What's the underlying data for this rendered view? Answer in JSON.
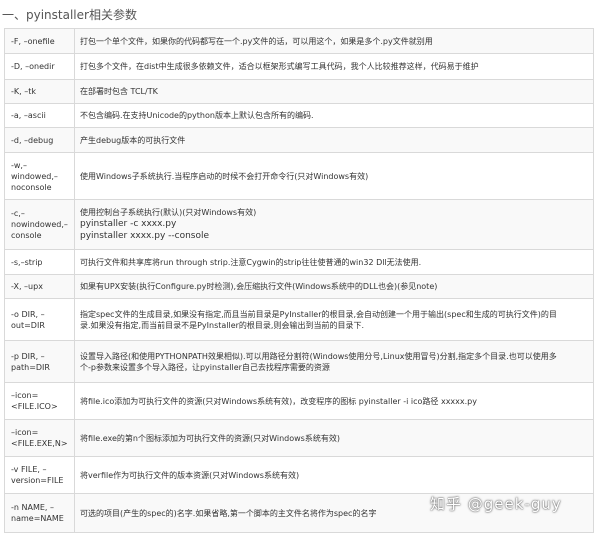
{
  "heading": "一、pyinstaller相关参数",
  "rows": [
    {
      "option": "-F, –onefile",
      "desc": [
        "打包一个单个文件，如果你的代码都写在一个.py文件的话，可以用这个，如果是多个.py文件就别用"
      ]
    },
    {
      "option": "-D, –onedir",
      "desc": [
        "打包多个文件，在dist中生成很多依赖文件，适合以框架形式编写工具代码，我个人比较推荐这样，代码易于维护"
      ]
    },
    {
      "option": "-K, –tk",
      "desc": [
        "在部署时包含 TCL/TK"
      ]
    },
    {
      "option": "-a, –ascii",
      "desc": [
        "不包含编码.在支持Unicode的python版本上默认包含所有的编码."
      ]
    },
    {
      "option": "-d, –debug",
      "desc": [
        "产生debug版本的可执行文件"
      ]
    },
    {
      "option": "-w,–windowed,–noconsole",
      "desc": [
        "使用Windows子系统执行.当程序启动的时候不会打开命令行(只对Windows有效)"
      ]
    },
    {
      "option": "-c,–nowindowed,–console",
      "desc": [
        "使用控制台子系统执行(默认)(只对Windows有效)",
        "pyinstaller -c  xxxx.py",
        "pyinstaller xxxx.py --console"
      ]
    },
    {
      "option": "-s,–strip",
      "desc": [
        "可执行文件和共享库将run through strip.注意Cygwin的strip往往使普通的win32 Dll无法使用."
      ]
    },
    {
      "option": "-X, –upx",
      "desc": [
        "如果有UPX安装(执行Configure.py时检测),会压缩执行文件(Windows系统中的DLL也会)(参见note)"
      ]
    },
    {
      "option": "-o DIR, –out=DIR",
      "desc": [
        "指定spec文件的生成目录,如果没有指定,而且当前目录是PyInstaller的根目录,会自动创建一个用于输出(spec和生成的可执行文件)的目",
        "录.如果没有指定,而当前目录不是PyInstaller的根目录,则会输出到当前的目录下."
      ]
    },
    {
      "option": "-p DIR, –path=DIR",
      "desc": [
        "设置导入路径(和使用PYTHONPATH效果相似).可以用路径分割符(Windows使用分号,Linux使用冒号)分割,指定多个目录.也可以使用多",
        "个-p参数来设置多个导入路径，让pyinstaller自己去找程序需要的资源"
      ]
    },
    {
      "option": "–icon=<FILE.ICO>",
      "desc": [
        "将file.ico添加为可执行文件的资源(只对Windows系统有效)，改变程序的图标  pyinstaller -i  ico路径 xxxxx.py"
      ]
    },
    {
      "option": "–icon=<FILE.EXE,N>",
      "desc": [
        "将file.exe的第n个图标添加为可执行文件的资源(只对Windows系统有效)"
      ]
    },
    {
      "option": "-v FILE, –version=FILE",
      "desc": [
        "将verfile作为可执行文件的版本资源(只对Windows系统有效)"
      ]
    },
    {
      "option": "-n NAME, –name=NAME",
      "desc": [
        "可选的项目(产生的spec的)名字.如果省略,第一个脚本的主文件名将作为spec的名字"
      ]
    }
  ],
  "watermark": "知乎 @geek-guy"
}
